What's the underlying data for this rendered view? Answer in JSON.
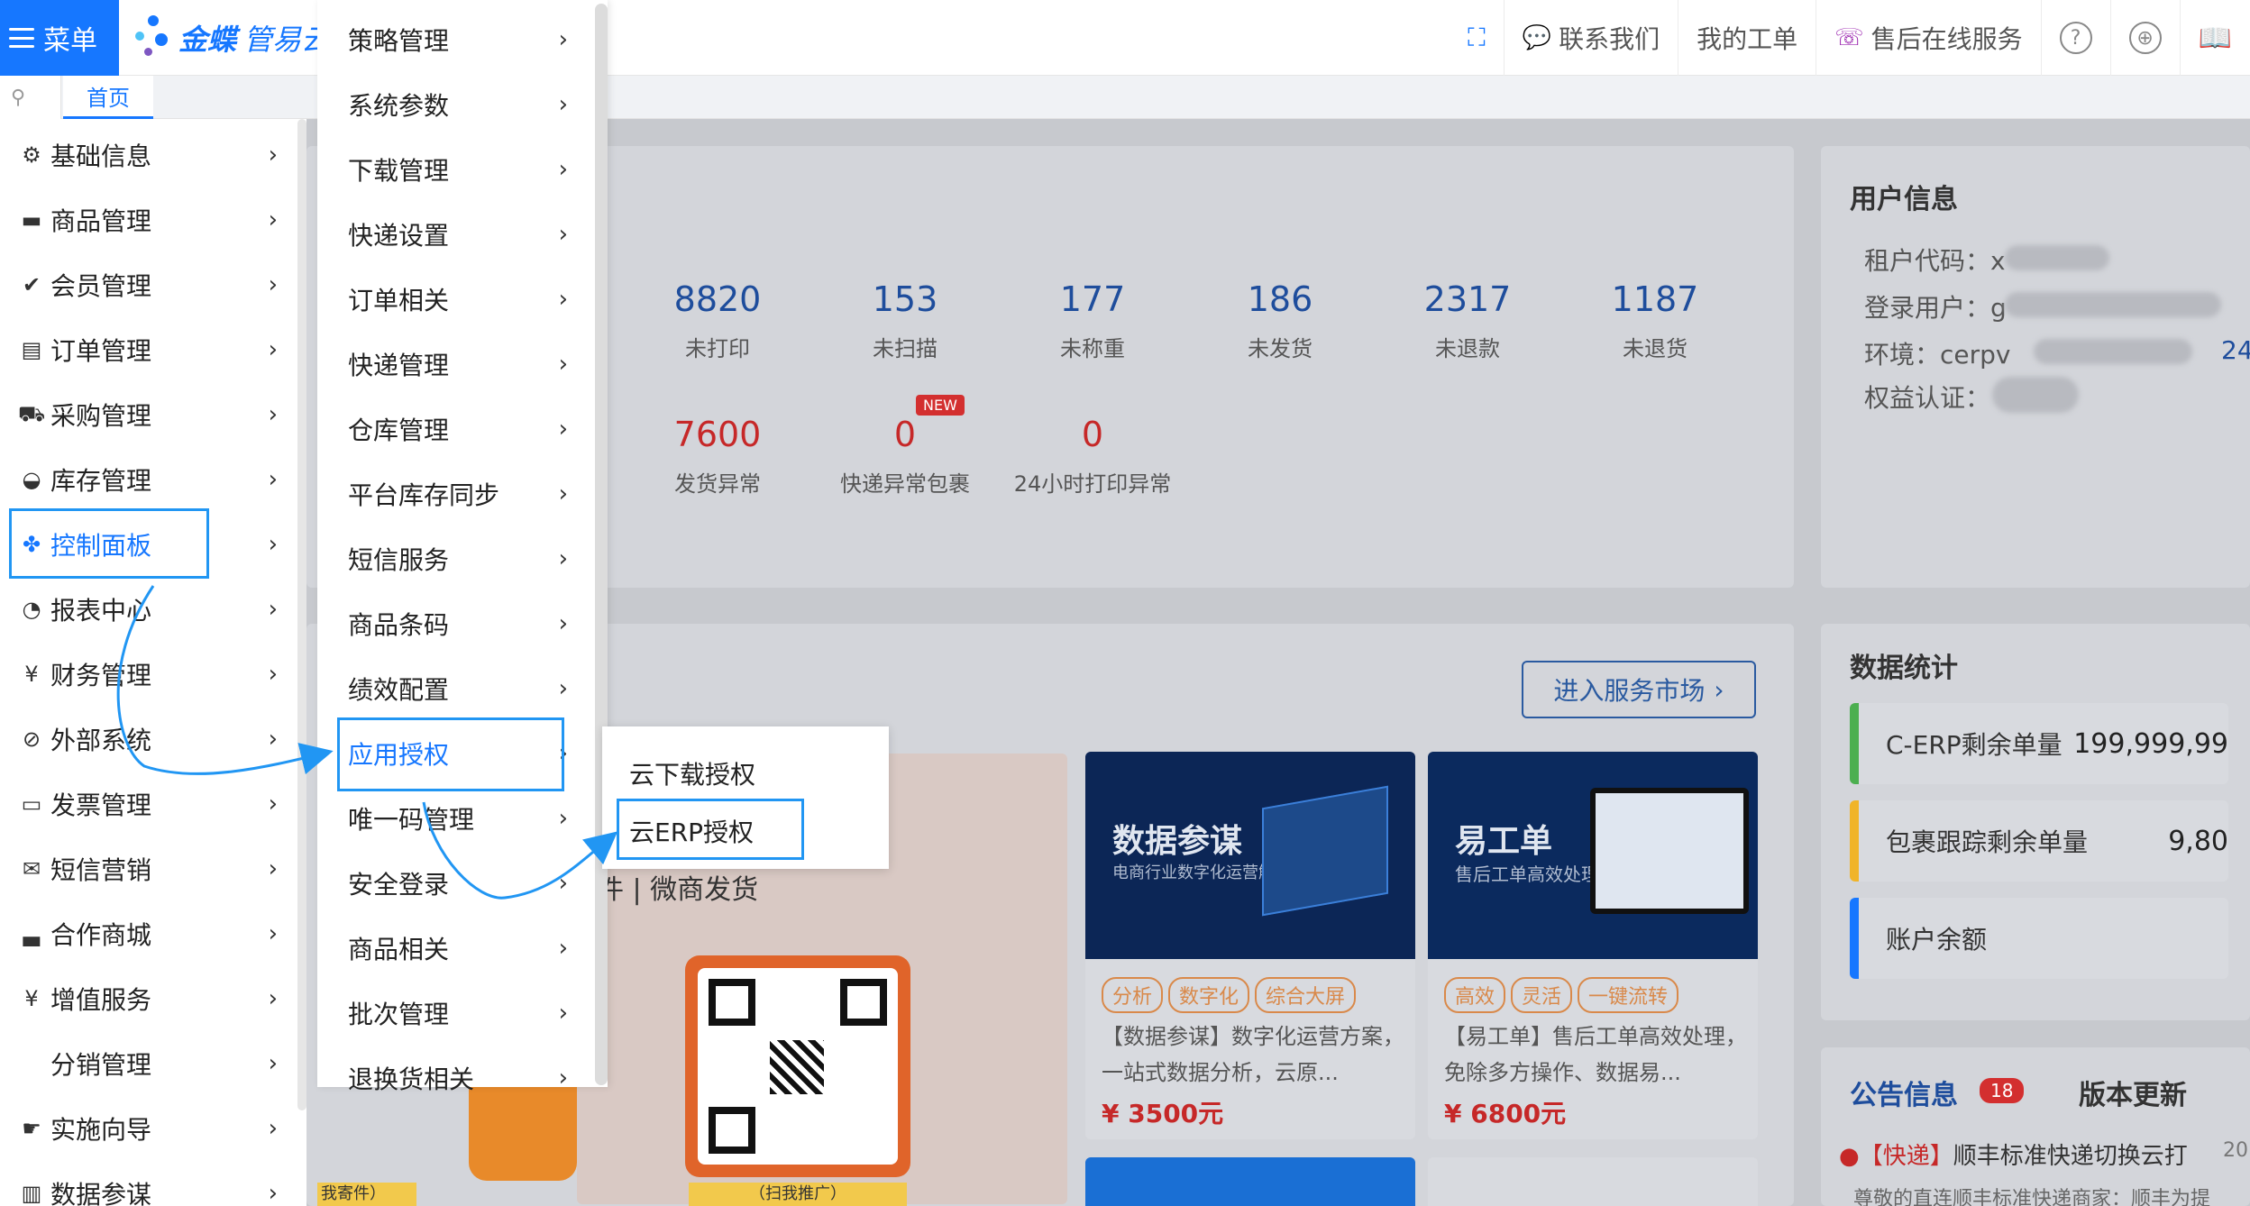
{
  "topbar": {
    "menu_label": "菜单",
    "brand_name": "金蝶",
    "brand_suffix": "管易云",
    "links": [
      {
        "label": "",
        "icon": "fullscreen-icon"
      },
      {
        "label": "联系我们",
        "icon": "chat-icon"
      },
      {
        "label": "我的工单",
        "icon": ""
      },
      {
        "label": "售后在线服务",
        "icon": "service-icon"
      },
      {
        "label": "",
        "icon": "help-icon"
      },
      {
        "label": "",
        "icon": "globe-icon"
      },
      {
        "label": "",
        "icon": "book-icon"
      }
    ]
  },
  "tabs": {
    "home": "首页"
  },
  "sidebar": {
    "items": [
      {
        "label": "基础信息",
        "icon": "gear-icon",
        "glyph": "⚙"
      },
      {
        "label": "商品管理",
        "icon": "store-icon",
        "glyph": "▬"
      },
      {
        "label": "会员管理",
        "icon": "check-icon",
        "glyph": "✔"
      },
      {
        "label": "订单管理",
        "icon": "clipboard-icon",
        "glyph": "▤"
      },
      {
        "label": "采购管理",
        "icon": "cart-icon",
        "glyph": "⛟"
      },
      {
        "label": "库存管理",
        "icon": "warehouse-icon",
        "glyph": "◒"
      },
      {
        "label": "控制面板",
        "icon": "dashboard-icon",
        "glyph": "✤"
      },
      {
        "label": "报表中心",
        "icon": "pie-chart-icon",
        "glyph": "◔"
      },
      {
        "label": "财务管理",
        "icon": "finance-icon",
        "glyph": "¥"
      },
      {
        "label": "外部系统",
        "icon": "link-icon",
        "glyph": "⊘"
      },
      {
        "label": "发票管理",
        "icon": "invoice-icon",
        "glyph": "▭"
      },
      {
        "label": "短信营销",
        "icon": "mail-icon",
        "glyph": "✉"
      },
      {
        "label": "合作商城",
        "icon": "shop-icon",
        "glyph": "▃"
      },
      {
        "label": "增值服务",
        "icon": "yen-icon",
        "glyph": "¥"
      },
      {
        "label": "分销管理",
        "icon": "",
        "glyph": ""
      },
      {
        "label": "实施向导",
        "icon": "guide-icon",
        "glyph": "☛"
      },
      {
        "label": "数据参谋",
        "icon": "data-icon",
        "glyph": "▥"
      }
    ]
  },
  "submenu": {
    "items": [
      "策略管理",
      "系统参数",
      "下载管理",
      "快递设置",
      "订单相关",
      "快递管理",
      "仓库管理",
      "平台库存同步",
      "短信服务",
      "商品条码",
      "绩效配置",
      "应用授权",
      "唯一码管理",
      "安全登录",
      "商品相关",
      "批次管理",
      "退换货相关"
    ]
  },
  "submenu3": {
    "items": [
      "云下载授权",
      "云ERP授权"
    ]
  },
  "dashboard": {
    "stats": [
      {
        "value": "8820",
        "label": "未打印"
      },
      {
        "value": "153",
        "label": "未扫描"
      },
      {
        "value": "177",
        "label": "未称重"
      },
      {
        "value": "186",
        "label": "未发货"
      },
      {
        "value": "2317",
        "label": "未退款"
      },
      {
        "value": "1187",
        "label": "未退货"
      }
    ],
    "exceptions": [
      {
        "value": "7600",
        "label": "发货异常"
      },
      {
        "value": "0",
        "label": "快递异常包裹",
        "badge": "NEW"
      },
      {
        "value": "0",
        "label": "24小时打印异常"
      }
    ],
    "user_info": {
      "title": "用户信息",
      "tenant_label": "租户代码：",
      "tenant_prefix": "x",
      "login_label": "登录用户：",
      "login_prefix": "g",
      "env_label": "环境：",
      "env_value": "cerpv",
      "env_suffix": "24",
      "rights_label": "权益认证："
    },
    "service_market": "进入服务市场",
    "promo_text": "件 | 微商发货",
    "qr_caption_left": "我寄件）",
    "qr_caption_right": "（扫我推广）",
    "products": [
      {
        "title": "数据参谋",
        "subtitle": "电商行业数字化运营解决方案",
        "tags": [
          "分析",
          "数字化",
          "综合大屏"
        ],
        "desc": "【数据参谋】数字化运营方案，一站式数据分析，云原...",
        "price": "¥ 3500元"
      },
      {
        "title": "易工单",
        "subtitle": "售后工单高效处理",
        "tags": [
          "高效",
          "灵活",
          "一键流转"
        ],
        "desc": "【易工单】售后工单高效处理，免除多方操作、数据易...",
        "price": "¥ 6800元"
      }
    ],
    "data_stats": {
      "title": "数据统计",
      "items": [
        {
          "label": "C-ERP剩余单量",
          "value": "199,999,99",
          "color": "#4caf50"
        },
        {
          "label": "包裹跟踪剩余单量",
          "value": "9,80",
          "color": "#f0b429"
        },
        {
          "label": "账户余额",
          "value": "",
          "color": "#1677ff"
        }
      ]
    },
    "notice": {
      "title": "公告信息",
      "count": "18",
      "version_title": "版本更新",
      "headline_tag": "【快递】",
      "headline": "顺丰标准快递切换云打",
      "headline_date": "20",
      "subline": "尊敬的直连顺丰标准快递商家：顺丰为提"
    }
  },
  "colors": {
    "accent": "#1677ff",
    "highlight_border": "#2196f3",
    "price_red": "#c62828"
  }
}
